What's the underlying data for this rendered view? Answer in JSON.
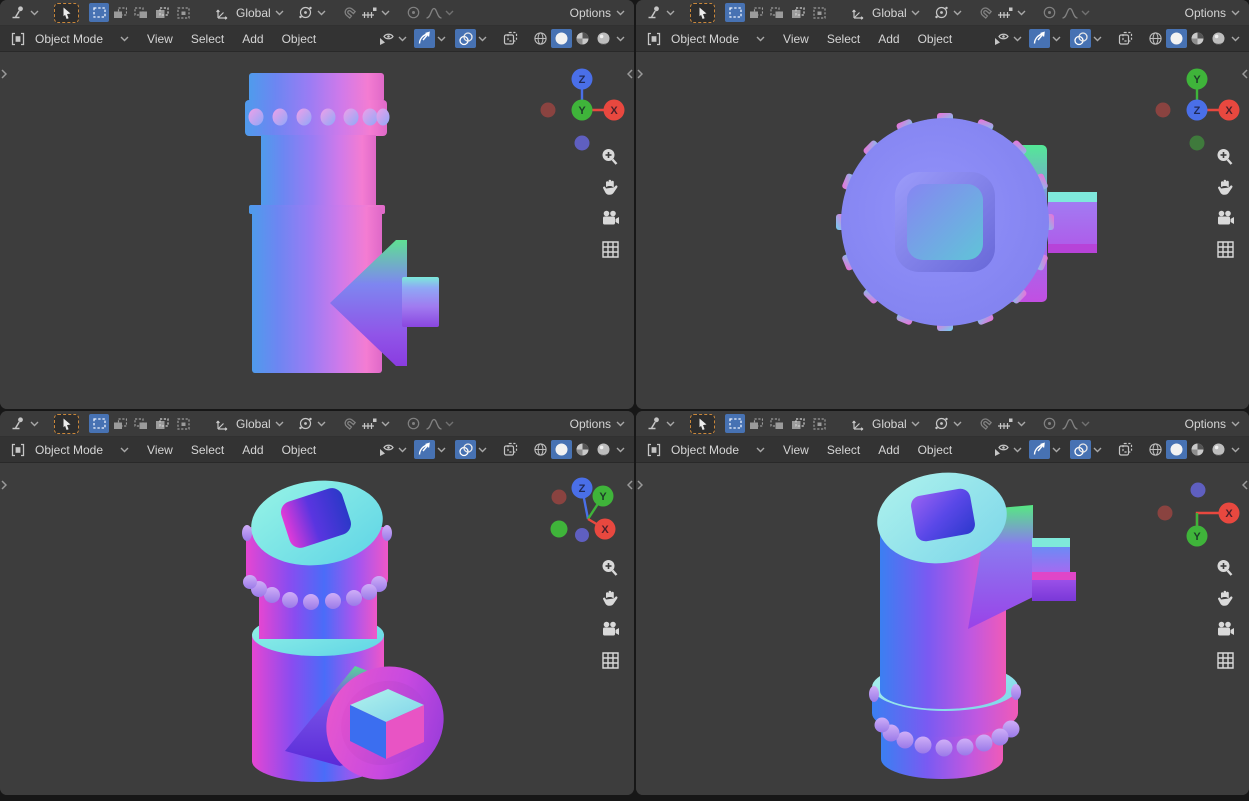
{
  "toolbar": {
    "orientation_label": "Global",
    "options_label": "Options",
    "mode_label": "Object Mode",
    "menus": [
      "View",
      "Select",
      "Add",
      "Object"
    ]
  },
  "colors": {
    "accent_toggle": "#4772b3",
    "active_tool_outline": "#c9873b",
    "axis_x": "#e8483f",
    "axis_y": "#3fb43a",
    "axis_z": "#4a6fe8",
    "header_bg": "#3b3b3b",
    "viewport_bg": "#3d3d3d"
  },
  "viewports": [
    {
      "name": "top-left",
      "axes": {
        "top": "Z",
        "center": "Y",
        "side": "X"
      }
    },
    {
      "name": "top-right",
      "axes": {
        "top": "Y",
        "center": "Z",
        "side": "X"
      }
    },
    {
      "name": "bottom-left",
      "axes": {
        "a": "Z",
        "b": "Y",
        "c": "X"
      }
    },
    {
      "name": "bottom-right",
      "axes": {
        "side": "X",
        "down": "Y"
      }
    }
  ]
}
